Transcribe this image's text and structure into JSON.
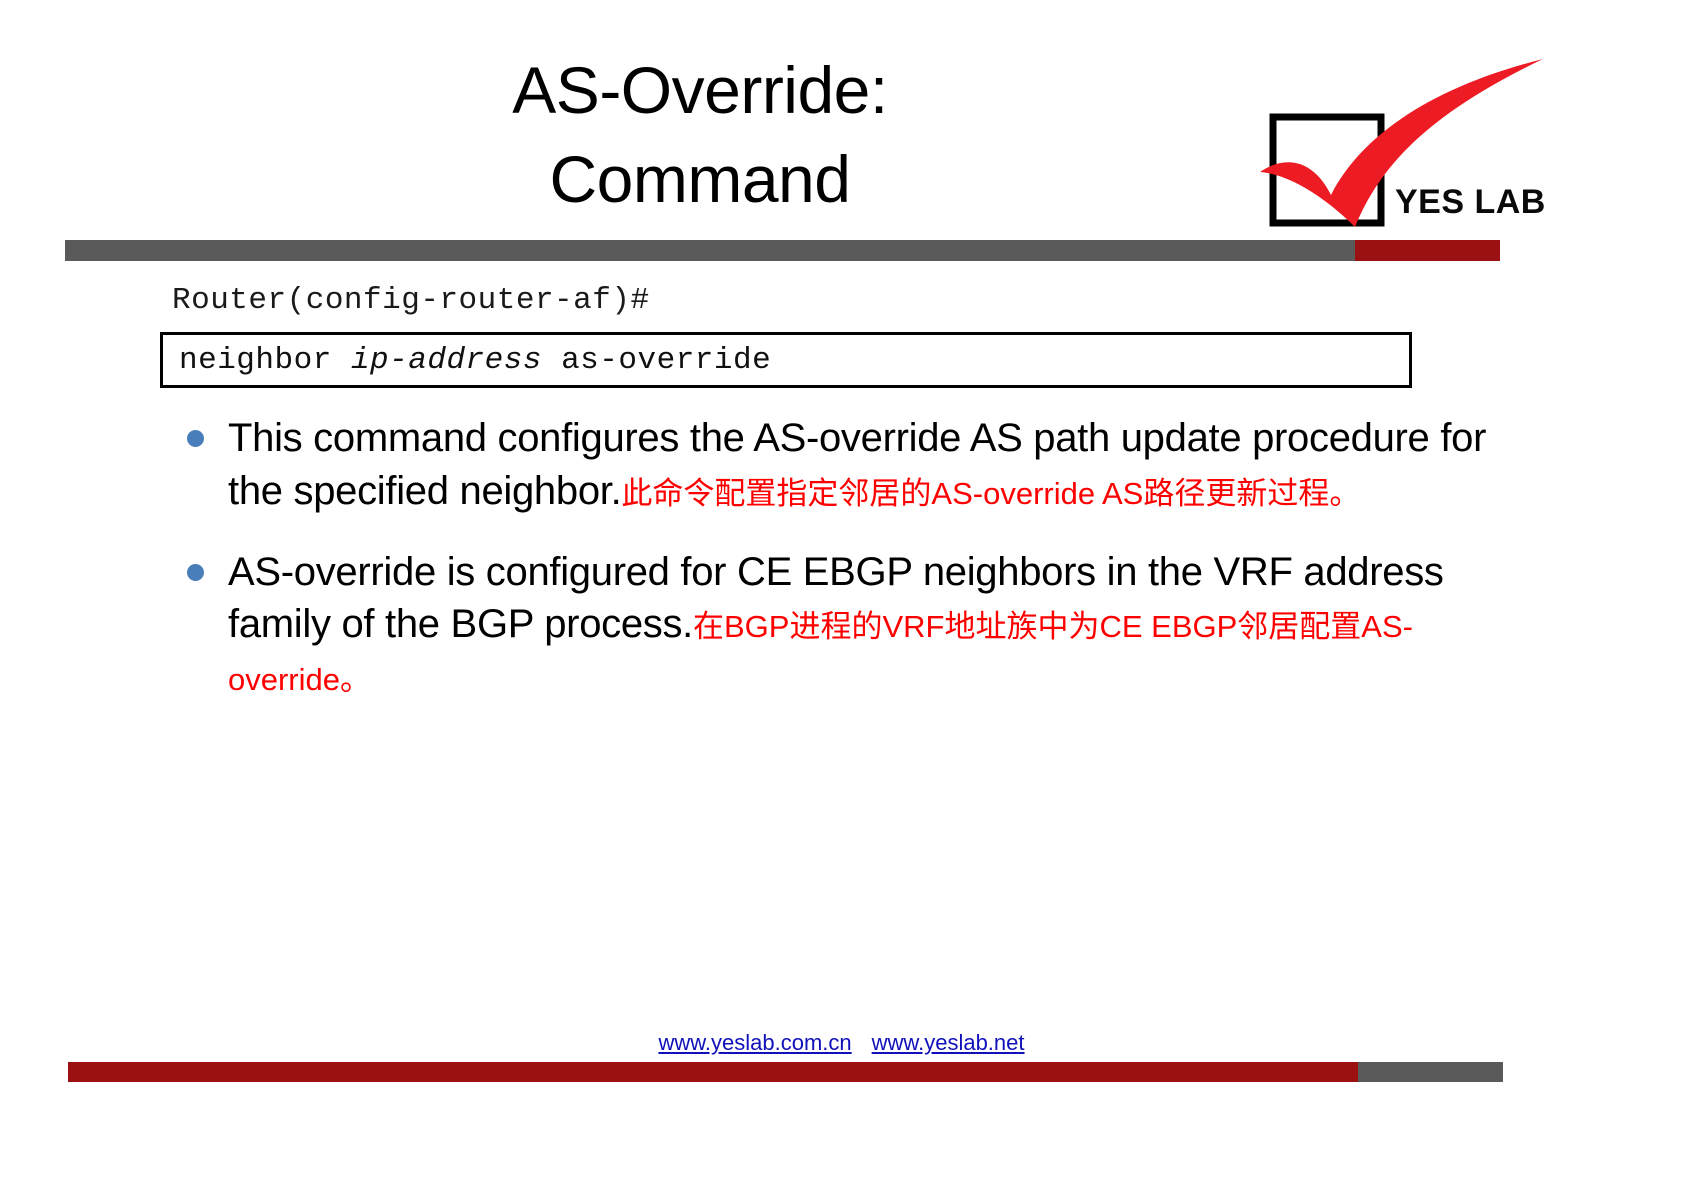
{
  "slide": {
    "title_lines": [
      "AS-Override:",
      "Command"
    ],
    "logo": {
      "text": "YES LAB",
      "check_color": "#ED1C24",
      "box_color": "#000000"
    },
    "accent_colors": {
      "gray_rule": "#5A5A5A",
      "red_rule": "#9B1111",
      "bullet_blue": "#4A7EBB",
      "chinese_red": "#FF0000",
      "link_blue": "#1111BB"
    },
    "code": {
      "prompt": "Router(config-router-af)#",
      "command_prefix": "neighbor ",
      "command_param": "ip-address",
      "command_suffix": " as-override"
    },
    "bullets": [
      {
        "english": "This command configures the AS-override AS path update procedure for the specified neighbor.",
        "chinese": "此命令配置指定邻居的AS-override AS路径更新过程。"
      },
      {
        "english": "AS-override is configured for CE EBGP neighbors in the VRF address family of the BGP process.",
        "chinese": "在BGP进程的VRF地址族中为CE EBGP邻居配置AS-override。"
      }
    ],
    "footer": {
      "link1": "www.yeslab.com.cn",
      "link2": "www.yeslab.net"
    }
  }
}
